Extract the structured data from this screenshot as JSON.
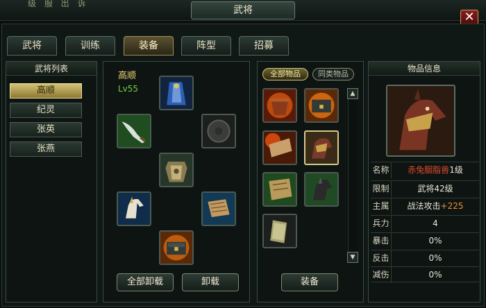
{
  "window": {
    "title": "武将",
    "top_left_text": "级 服 出 诉",
    "close_label": "✕"
  },
  "tabs": [
    {
      "label": "武将",
      "active": false
    },
    {
      "label": "训练",
      "active": false
    },
    {
      "label": "装备",
      "active": true
    },
    {
      "label": "阵型",
      "active": false
    },
    {
      "label": "招募",
      "active": false
    }
  ],
  "generals_panel": {
    "title": "武将列表",
    "items": [
      {
        "label": "高顺",
        "active": true
      },
      {
        "label": "纪灵",
        "active": false
      },
      {
        "label": "张英",
        "active": false
      },
      {
        "label": "张燕",
        "active": false
      }
    ]
  },
  "equip_panel": {
    "hero_name": "高顺",
    "hero_level": "Lv55",
    "slots": [
      {
        "name": "cloak-icon",
        "kind": "cloak"
      },
      {
        "name": "blade-weapon-icon",
        "kind": "blade"
      },
      {
        "name": "empty-shield-slot-icon",
        "kind": "shield"
      },
      {
        "name": "armor-icon",
        "kind": "armor"
      },
      {
        "name": "war-horse-icon",
        "kind": "horse"
      },
      {
        "name": "scroll-book-icon",
        "kind": "scroll"
      },
      {
        "name": "treasure-box-icon",
        "kind": "box"
      }
    ],
    "unequip_all_label": "全部卸载",
    "unequip_label": "卸载"
  },
  "inventory": {
    "filter_all": "全部物品",
    "filter_same": "同类物品",
    "items": [
      {
        "name": "inventory-cauldron-icon",
        "kind": "cauldron"
      },
      {
        "name": "inventory-box-icon",
        "kind": "box"
      },
      {
        "name": "inventory-scroll-fire-icon",
        "kind": "firescroll"
      },
      {
        "name": "inventory-horse-saddle-icon",
        "kind": "saddle",
        "selected": true
      },
      {
        "name": "inventory-map-icon",
        "kind": "map"
      },
      {
        "name": "inventory-black-horse-icon",
        "kind": "blackhorse"
      },
      {
        "name": "inventory-tablet-icon",
        "kind": "tablet"
      }
    ],
    "equip_label": "装备",
    "scroll_up": "▲",
    "scroll_down": "▼"
  },
  "item_info": {
    "title": "物品信息",
    "rows": [
      {
        "label": "名称",
        "value": "赤兔胭脂兽",
        "suffix": "1级"
      },
      {
        "label": "限制",
        "value": "武将42级"
      },
      {
        "label": "主属",
        "value": "战法攻击",
        "bonus": "+225"
      },
      {
        "label": "兵力",
        "value": "4"
      },
      {
        "label": "暴击",
        "value": "0%"
      },
      {
        "label": "反击",
        "value": "0%"
      },
      {
        "label": "减伤",
        "value": "0%"
      }
    ]
  }
}
